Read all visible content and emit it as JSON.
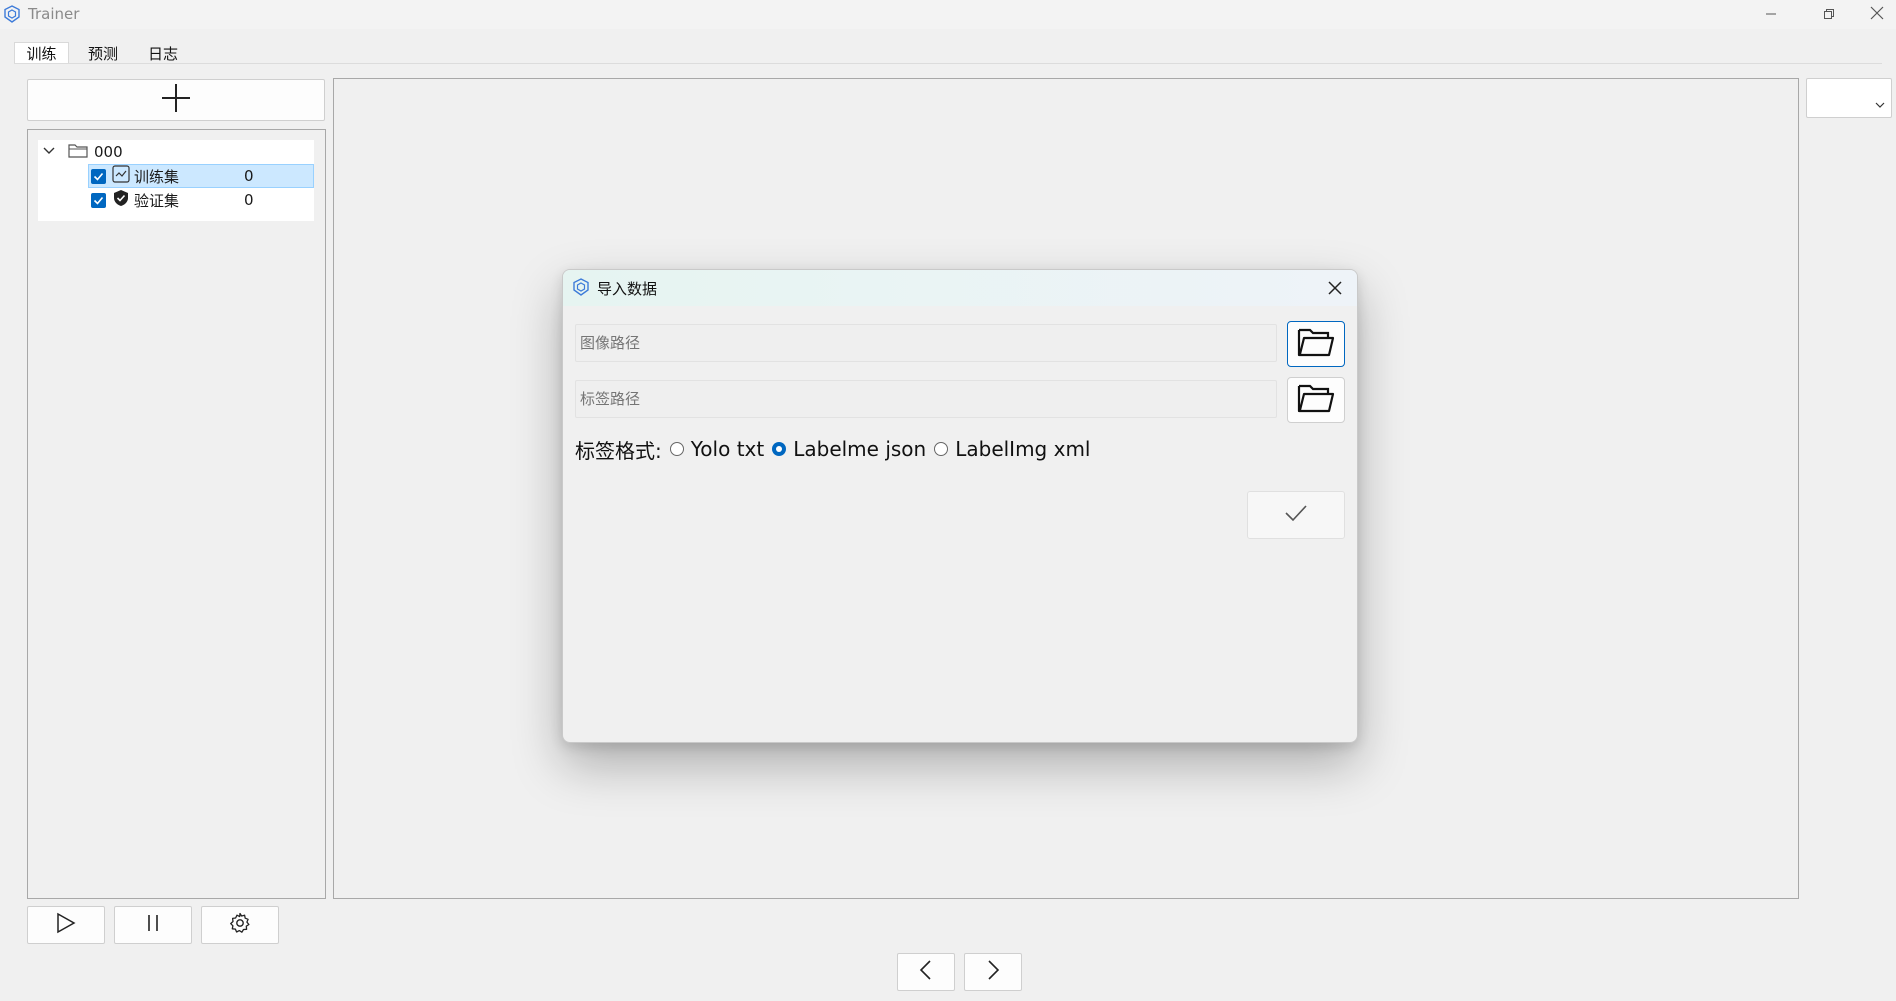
{
  "window": {
    "title": "Trainer",
    "icons": [
      "app-logo-icon",
      "minimize-icon",
      "restore-icon",
      "close-icon"
    ]
  },
  "tabs": [
    {
      "label": "训练",
      "active": true
    },
    {
      "label": "预测",
      "active": false
    },
    {
      "label": "日志",
      "active": false
    }
  ],
  "tree": {
    "root": {
      "label": "000",
      "icon": "folder-icon",
      "expanded": true
    },
    "children": [
      {
        "label": "训练集",
        "count": "0",
        "checked": true,
        "icon": "train-set-icon",
        "selected": true
      },
      {
        "label": "验证集",
        "count": "0",
        "checked": true,
        "icon": "shield-check-icon",
        "selected": false
      }
    ]
  },
  "toolbar": {
    "add_icon": "plus-icon",
    "play_icon": "play-icon",
    "pause_icon": "pause-icon",
    "settings_icon": "gear-icon",
    "prev_icon": "chevron-left-icon",
    "next_icon": "chevron-right-icon"
  },
  "dialog": {
    "title": "导入数据",
    "image_path_placeholder": "图像路径",
    "label_path_placeholder": "标签路径",
    "format_label": "标签格式:",
    "formats": [
      {
        "label": "Yolo txt",
        "selected": false
      },
      {
        "label": "Labelme json",
        "selected": true
      },
      {
        "label": "LabelImg xml",
        "selected": false
      }
    ],
    "confirm_icon": "check-icon"
  },
  "colors": {
    "accent": "#0067c0",
    "selection": "#cce8ff",
    "background": "#f0f0f0"
  }
}
